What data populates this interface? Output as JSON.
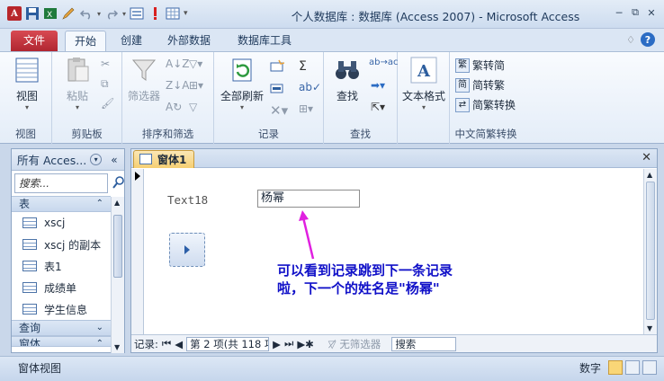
{
  "window": {
    "title": "个人数据库 : 数据库 (Access 2007)  -  Microsoft Access",
    "app_logo": "A",
    "qat_undo_caret": "▾",
    "controls": [
      "─",
      "⧉",
      "✕"
    ]
  },
  "ribbon_tabs": {
    "file": "文件",
    "home": "开始",
    "create": "创建",
    "external": "外部数据",
    "dbtools": "数据库工具",
    "collapse": "♢",
    "help": "?"
  },
  "ribbon": {
    "views": {
      "view_label": "视图",
      "group": "视图"
    },
    "clipboard": {
      "paste_label": "粘贴",
      "group": "剪贴板"
    },
    "sort_filter": {
      "filter_label": "筛选器",
      "group": "排序和筛选"
    },
    "records": {
      "refresh_label": "全部刷新",
      "group": "记录"
    },
    "find": {
      "find_label": "查找",
      "group": "查找"
    },
    "text_format": {
      "label": "文本格式"
    },
    "chinese": {
      "to_traditional": "繁转简",
      "to_simplified": "简转繁",
      "convert": "简繁转换",
      "group": "中文简繁转换"
    }
  },
  "nav_pane": {
    "title": "所有 Acces...",
    "search_placeholder": "搜索...",
    "groups": {
      "tables": "表",
      "queries": "查询",
      "forms": "窗体"
    },
    "items": [
      "xscj",
      "xscj 的副本",
      "表1",
      "成绩单",
      "学生信息"
    ]
  },
  "document": {
    "tab_label": "窗体1",
    "close": "✕",
    "field_label": "Text18",
    "field_value": "杨幂",
    "annotation_line1": "可以看到记录跳到下一条记录",
    "annotation_line2": "啦，下一个的姓名是\"杨幂\""
  },
  "record_nav": {
    "label": "记录:",
    "current": "第 2 项(共 118 项)",
    "no_filter": "无筛选器",
    "search": "搜索"
  },
  "status": {
    "left": "窗体视图",
    "mode": "数字"
  },
  "colors": {
    "accent_file_tab": "#b02631",
    "active_doc_tab": "#f6cf72",
    "annotation_text": "#1010c8",
    "annotation_arrow": "#e020e0"
  }
}
